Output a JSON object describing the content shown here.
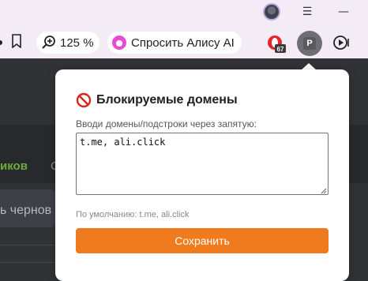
{
  "window": {
    "minimize_icon": "minimize-icon",
    "menu_icon": "hamburger-menu-icon",
    "avatar_icon": "user-avatar"
  },
  "toolbar": {
    "zoom_label": "125 %",
    "alice_label": "Спросить Алису AI",
    "extension_badge_count": "67",
    "extension_p_letter": "P"
  },
  "page": {
    "tab_active_fragment": "иков",
    "tab_inactive_fragment": "С",
    "draft_fragment": "ь чернов"
  },
  "popup": {
    "title": "Блокируемые домены",
    "hint": "Вводи домены/подстроки через запятую:",
    "domains_value": "t.me, ali.click",
    "default_text": "По умолчанию: t.me, ali.click",
    "save_label": "Сохранить"
  },
  "colors": {
    "accent_orange": "#f07a1e",
    "tab_green": "#6cae3c",
    "browser_chrome": "#f3ecf6",
    "alice_pink": "#e84ad8"
  }
}
